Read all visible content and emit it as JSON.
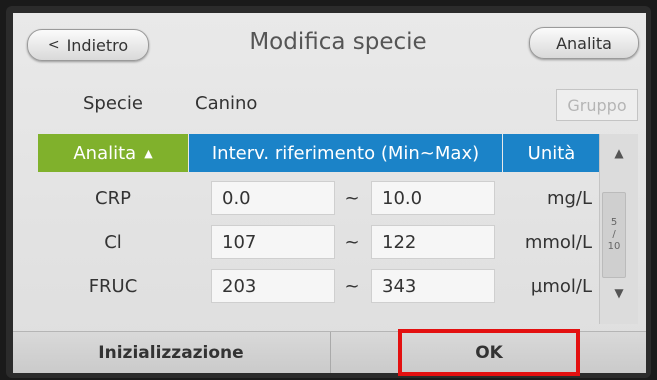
{
  "header": {
    "back_label": "Indietro",
    "back_icon": "chevron-left-icon",
    "title": "Modifica specie",
    "analita_button": "Analita"
  },
  "species": {
    "label": "Specie",
    "value": "Canino",
    "group_button": "Gruppo"
  },
  "table": {
    "columns": {
      "analita": "Analita",
      "range": "Interv. riferimento (Min~Max)",
      "unit": "Unità"
    },
    "sort_icon": "sort-up-icon",
    "rows": [
      {
        "name": "CRP",
        "min": "0.0",
        "sep": "~",
        "max": "10.0",
        "unit": "mg/L"
      },
      {
        "name": "Cl",
        "min": "107",
        "sep": "~",
        "max": "122",
        "unit": "mmol/L"
      },
      {
        "name": "FRUC",
        "min": "203",
        "sep": "~",
        "max": "343",
        "unit": "µmol/L"
      }
    ]
  },
  "scrollbar": {
    "page_current": "5",
    "page_sep": "/",
    "page_total": "10"
  },
  "footer": {
    "init_label": "Inizializzazione",
    "ok_label": "OK"
  },
  "colors": {
    "analita_header": "#80b12c",
    "range_header": "#1b83c8",
    "highlight": "#e31010"
  }
}
